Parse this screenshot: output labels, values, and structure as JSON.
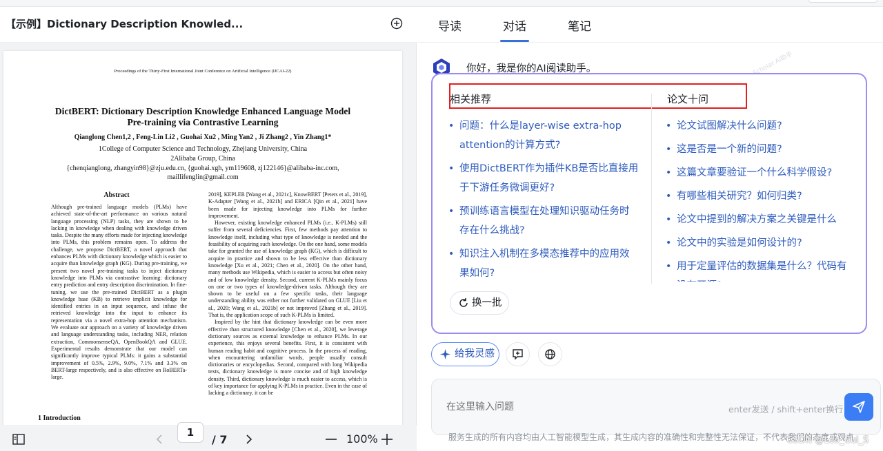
{
  "doc": {
    "title": "【示例】Dictionary Description Knowled...",
    "page": {
      "proceedings": "Proceedings of the Thirty-First International Joint Conference on Artificial Intelligence (IJCAI-22)",
      "title_line1": "DictBERT: Dictionary Description Knowledge Enhanced Language Model",
      "title_line2": "Pre-training via Contrastive Learning",
      "authors": "Qianglong Chen1,2 , Feng-Lin Li2 , Guohai Xu2 , Ming Yan2 , Ji Zhang2 , Yin Zhang1*",
      "aff1": "1College of Computer Science and Technology, Zhejiang University, China",
      "aff2": "2Alibaba Group, China",
      "emails1": "{chenqianglong, zhangyin98}@zju.edu.cn, {guohai.xgh, ym119608, zj122146}@alibaba-inc.com,",
      "emails2": "maillifenglin@gmail.com",
      "abstract_heading": "Abstract",
      "abstract_text": "Although pre-trained language models (PLMs) have achieved state-of-the-art performance on various natural language processing (NLP) tasks, they are shown to be lacking in knowledge when dealing with knowledge driven tasks. Despite the many efforts made for injecting knowledge into PLMs, this problem remains open. To address the challenge, we propose DictBERT, a novel approach that enhances PLMs with dictionary knowledge which is easier to acquire than knowledge graph (KG). During pre-training, we present two novel pre-training tasks to inject dictionary knowledge into PLMs via contrastive learning: dictionary entry prediction and entry description discrimination. In fine-tuning, we use the pre-trained DictBERT as a plugin knowledge base (KB) to retrieve implicit knowledge for identified entries in an input sequence, and infuse the retrieved knowledge into the input to enhance its representation via a novel extra-hop attention mechanism. We evaluate our approach on a variety of knowledge driven and language understanding tasks, including NER, relation extraction, CommonsenseQA, OpenBookQA and GLUE. Experimental results demonstrate that our model can significantly improve typical PLMs: it gains a substantial improvement of 0.5%, 2.9%, 9.0%, 7.1% and 3.3% on BERT-large respectively, and is also effective on RoBERTa-large.",
      "right_p1": "2019], KEPLER [Wang et al., 2021c], KnowBERT [Peters et al., 2019], K-Adapter [Wang et al., 2021b] and ERICA [Qin et al., 2021] have been made for injecting knowledge into PLMs for further improvement.",
      "right_p2": "However, existing knowledge enhanced PLMs (i.e., K-PLMs) still suffer from several deficiencies. First, few methods pay attention to knowledge itself, including what type of knowledge is needed and the feasibility of acquiring such knowledge. On the one hand, some models take for granted the use of knowledge graph (KG), which is difficult to acquire in practice and shown to be less effective than dictionary knowledge [Xu et al., 2021; Chen et al., 2020]. On the other hand, many methods use Wikipedia, which is easier to access but often noisy and of low knowledge density. Second, current K-PLMs mainly focus on one or two types of knowledge-driven tasks. Although they are shown to be useful on a few specific tasks, their language understanding ability was either not further validated on GLUE [Liu et al., 2020; Wang et al., 2021b] or not improved [Zhang et al., 2019]. That is, the application scope of such K-PLMs is limited.",
      "right_p3": "Inspired by the hint that dictionary knowledge can be even more effective than structured knowledge [Chen et al., 2020], we leverage dictionary sources as external knowledge to enhance PLMs. In our experience, this enjoys several benefits. First, it is consistent with human reading habit and cognitive process. In the process of reading, when encountering unfamiliar words, people usually consult dictionaries or encyclopedias. Second, compared with long Wikipedia texts, dictionary knowledge is more concise and of high knowledge density. Third, dictionary knowledge is much easier to access, which is of key importance for applying K-PLMs in practice. Even in the case of lacking a dictionary, it can be",
      "intro": "1   Introduction"
    },
    "footer": {
      "current_page": "1",
      "total_pages": "/ 7",
      "zoom": "100%"
    }
  },
  "chat": {
    "tabs": [
      "导读",
      "对话",
      "笔记"
    ],
    "active_tab": "对话",
    "greeting": "你好，我是你的AI阅读助手。",
    "watermark": "Scholar AI助手",
    "related_heading": "相关推荐",
    "ten_heading": "论文十问",
    "related": [
      [
        "问题：什么是layer-wise extra-hop",
        "attention的计算方式?"
      ],
      [
        "使用DictBERT作为插件KB是否比直接用",
        "于下游任务微调更好?"
      ],
      [
        "预训练语言模型在处理知识驱动任务时",
        "存在什么挑战?"
      ],
      [
        "知识注入机制在多模态推荐中的应用效",
        "果如何?"
      ]
    ],
    "ten": [
      "论文试图解决什么问题?",
      "这是否是一个新的问题?",
      "这篇文章要验证一个什么科学假设?",
      "有哪些相关研究？如何归类?",
      "论文中提到的解决方案之关键是什么",
      "论文中的实验是如何设计的?",
      "用于定量评估的数据集是什么？代码有",
      "没有开源?"
    ],
    "refresh_label": "换一批",
    "inspire_label": "给我灵感",
    "input_placeholder": "在这里输入问题",
    "input_hint": "enter发送 / shift+enter换行",
    "disclaimer": "服务生成的所有内容均由人工智能模型生成，其生成内容的准确性和完整性无法保证，不代表我们的态度或观点",
    "csdn": "CSDN @Leo_Cui_S"
  },
  "colors": {
    "accent": "#3a7df5",
    "link": "#2d5bbd",
    "card_border": "#9b8cf0",
    "highlight_box": "#e02020"
  }
}
